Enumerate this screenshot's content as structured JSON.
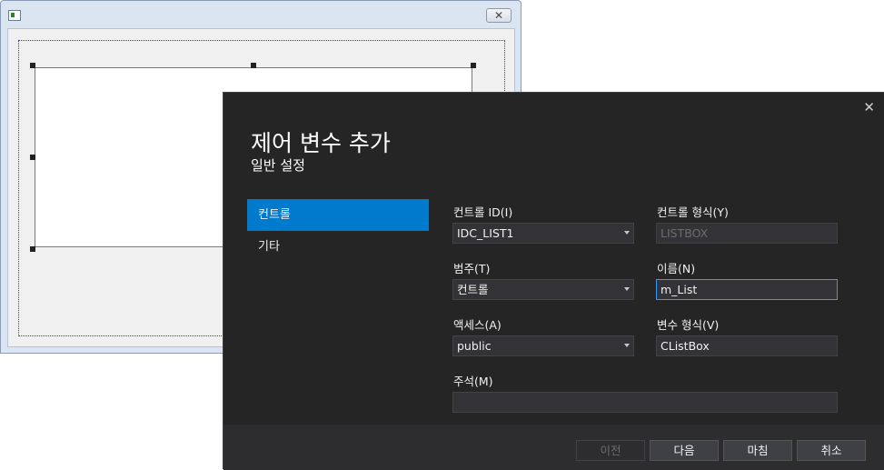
{
  "dialog": {
    "close_glyph": "✕",
    "title": "제어 변수 추가",
    "subtitle": "일반 설정",
    "nav": [
      {
        "label": "컨트롤",
        "active": true
      },
      {
        "label": "기타",
        "active": false
      }
    ],
    "fields": {
      "control_id": {
        "label": "컨트롤 ID(I)",
        "value": "IDC_LIST1"
      },
      "control_type": {
        "label": "컨트롤 형식(Y)",
        "value": "LISTBOX"
      },
      "category": {
        "label": "범주(T)",
        "value": "컨트롤"
      },
      "name": {
        "label": "이름(N)",
        "value": "m_List"
      },
      "access": {
        "label": "액세스(A)",
        "value": "public"
      },
      "var_type": {
        "label": "변수 형식(V)",
        "value": "CListBox"
      },
      "comment": {
        "label": "주석(M)",
        "value": ""
      }
    },
    "buttons": {
      "prev": "이전",
      "next": "다음",
      "finish": "마침",
      "cancel": "취소"
    }
  },
  "background_window": {
    "close_glyph": "✕"
  },
  "colors": {
    "dialog_bg": "#252526",
    "accent": "#007acc",
    "focus_border": "#3399ff"
  }
}
